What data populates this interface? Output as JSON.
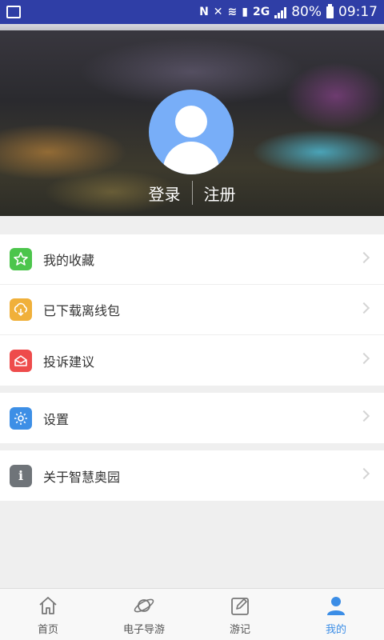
{
  "status_bar": {
    "battery": "80%",
    "time": "09:17",
    "network": "2G"
  },
  "profile": {
    "login_label": "登录",
    "register_label": "注册"
  },
  "menu_groups": [
    [
      {
        "label": "我的收藏",
        "icon": "star-icon",
        "color": "#4cc54c"
      },
      {
        "label": "已下载离线包",
        "icon": "cloud-download-icon",
        "color": "#f0b03a"
      },
      {
        "label": "投诉建议",
        "icon": "complaint-icon",
        "color": "#ee4b4b"
      }
    ],
    [
      {
        "label": "设置",
        "icon": "gear-icon",
        "color": "#3d8fe6"
      }
    ],
    [
      {
        "label": "关于智慧奥园",
        "icon": "info-icon",
        "color": "#6f7479"
      }
    ]
  ],
  "tabs": [
    {
      "label": "首页",
      "icon": "home-icon",
      "active": false
    },
    {
      "label": "电子导游",
      "icon": "planet-icon",
      "active": false
    },
    {
      "label": "游记",
      "icon": "edit-icon",
      "active": false
    },
    {
      "label": "我的",
      "icon": "user-icon",
      "active": true
    }
  ],
  "colors": {
    "status_bar": "#2f3ea6",
    "avatar": "#78aef8",
    "active_tab": "#3b8de6"
  }
}
